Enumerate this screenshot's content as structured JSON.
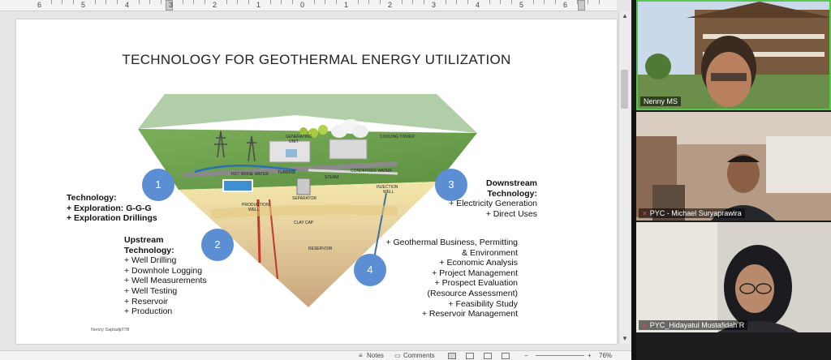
{
  "ruler": {
    "numbers": [
      "6",
      "5",
      "4",
      "3",
      "2",
      "1",
      "0",
      "1",
      "2",
      "3",
      "4",
      "5",
      "6"
    ]
  },
  "slide": {
    "title": "TECHNOLOGY FOR GEOTHERMAL ENERGY UTILIZATION",
    "steps": [
      "1",
      "2",
      "3",
      "4"
    ],
    "diagram_labels": {
      "generating_unit_1": "GENERATING",
      "generating_unit_2": "UNIT",
      "cooling_tower": "COOLING TOWER",
      "turbine": "TURBINE",
      "hot_brine_water": "HOT BRINE WATER",
      "steam": "STEAM",
      "condensed_water": "CONDENSED WATER",
      "separator": "SEPARATOR",
      "injection_well_1": "INJECTION",
      "injection_well_2": "WELL",
      "production_well_1": "PRODUCTION",
      "production_well_2": "WELL",
      "clay_cap": "CLAY CAP",
      "reservoir": "RESERVOIR"
    },
    "technology": {
      "heading": "Technology:",
      "items": [
        "+ Exploration: G-G-G",
        "+ Exploration Drillings"
      ]
    },
    "upstream": {
      "heading_1": "Upstream",
      "heading_2": "Technology:",
      "items": [
        "+ Well Drilling",
        "+ Downhole Logging",
        "+ Well Measurements",
        "+ Well Testing",
        "+ Reservoir",
        "+ Production"
      ]
    },
    "downstream": {
      "heading_1": "Downstream",
      "heading_2": "Technology:",
      "items": [
        "+ Electricity Generation",
        "+ Direct Uses"
      ]
    },
    "business": {
      "items": [
        "+ Geothermal Business, Permitting",
        "& Environment",
        "+ Economic Analysis",
        "+ Project Management",
        "+ Prospect Evaluation",
        "(Resource Assessment)",
        "+ Feasibility Study",
        "+ Reservoir Management"
      ]
    },
    "credit": "Nenny Saptadji/ITB"
  },
  "statusbar": {
    "notes": "Notes",
    "comments": "Comments",
    "zoom": "76%"
  },
  "participants": [
    {
      "name": "Nenny MS"
    },
    {
      "name": "PYC - Michael Suryaprawira"
    },
    {
      "name": "PYC_Hidayatul Mustafidah R"
    }
  ],
  "colors": {
    "accent_circle": "#5b8ed2",
    "active_speaker": "#57c84d",
    "muted": "#ff4040"
  }
}
